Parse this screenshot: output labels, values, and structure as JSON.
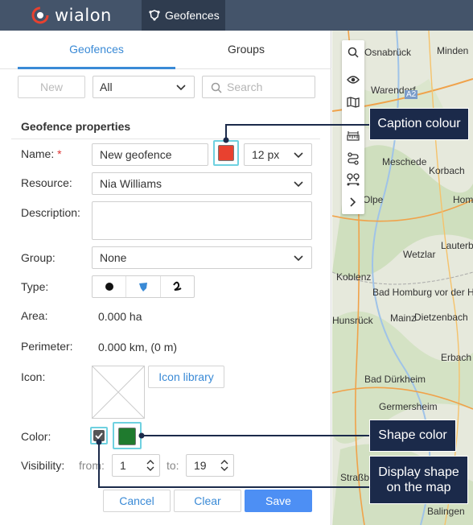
{
  "header": {
    "logo_text": "wialon",
    "app_tab_label": "Geofences"
  },
  "tabs": [
    {
      "label": "Geofences",
      "active": true
    },
    {
      "label": "Groups",
      "active": false
    }
  ],
  "toolbar": {
    "new_label": "New",
    "filter_value": "All",
    "search_placeholder": "Search"
  },
  "properties": {
    "title": "Geofence properties",
    "name_label": "Name:",
    "name_required_mark": "*",
    "name_value": "New geofence",
    "caption_colour": "#e8412f",
    "font_size_value": "12 px",
    "resource_label": "Resource:",
    "resource_value": "Nia Williams",
    "description_label": "Description:",
    "description_value": "",
    "group_label": "Group:",
    "group_value": "None",
    "type_label": "Type:",
    "type_options": [
      "point",
      "polygon",
      "line"
    ],
    "type_selected": "polygon",
    "area_label": "Area:",
    "area_value": "0.000 ha",
    "perimeter_label": "Perimeter:",
    "perimeter_value": "0.000 km, (0 m)",
    "icon_label": "Icon:",
    "icon_library_label": "Icon library",
    "color_label": "Color:",
    "display_shape_checked": true,
    "shape_color": "#1f7a2e",
    "visibility_label": "Visibility:",
    "from_label": "from:",
    "from_value": "1",
    "to_label": "to:",
    "to_value": "19"
  },
  "footer": {
    "cancel_label": "Cancel",
    "clear_label": "Clear",
    "save_label": "Save"
  },
  "map": {
    "labels": [
      "Osnabrück",
      "Minden",
      "Warendorf",
      "A2",
      "Meschede",
      "Korbach",
      "Olpe",
      "Hom",
      "Lauterb",
      "Wetzlar",
      "Koblenz",
      "Bad Homburg vor der Höhe",
      "Hunsrück",
      "Mainz",
      "Dietzenbach",
      "Erbach",
      "Bad Dürkheim",
      "Germersheim",
      "Straßb",
      "Balingen"
    ],
    "toolbar_icons": [
      "search-icon",
      "eye-icon",
      "map-icon",
      "ruler-icon",
      "route-icon",
      "points-icon",
      "chevron-right-icon"
    ]
  },
  "callouts": {
    "caption_colour": "Caption colour",
    "shape_color": "Shape color",
    "display_shape": "Display shape on the map"
  },
  "colors": {
    "accent": "#3a8ad6",
    "header_bg": "#44546a",
    "callout_bg": "#1b2a4a",
    "highlight": "#6fd1e0"
  }
}
